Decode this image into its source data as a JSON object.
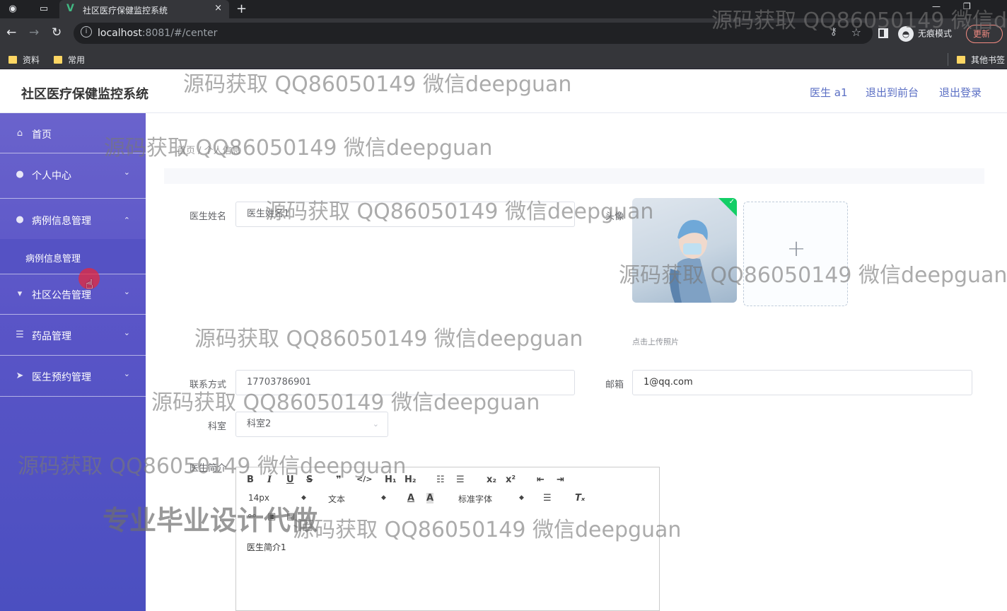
{
  "browser": {
    "tab_title": "社区医疗保健监控系统",
    "tab_close": "×",
    "new_tab": "+",
    "url_host": "localhost",
    "url_rest": ":8081/#/center",
    "incognito_label": "无痕模式",
    "update_label": "更新",
    "bookmarks": [
      "资料",
      "常用"
    ],
    "other_bookmarks": "其他书签"
  },
  "header": {
    "title": "社区医疗保健监控系统",
    "links": [
      "医生 a1",
      "退出到前台",
      "退出登录"
    ]
  },
  "sidebar": {
    "items": [
      {
        "label": "首页",
        "icon": "home-icon",
        "arrow": ""
      },
      {
        "label": "个人中心",
        "icon": "user-icon",
        "arrow": "⌄"
      },
      {
        "label": "病例信息管理",
        "icon": "user-icon",
        "arrow": "⌃"
      },
      {
        "label": "社区公告管理",
        "icon": "notice-icon",
        "arrow": "⌄"
      },
      {
        "label": "药品管理",
        "icon": "list-icon",
        "arrow": "⌄"
      },
      {
        "label": "医生预约管理",
        "icon": "send-icon",
        "arrow": "⌄"
      }
    ],
    "submenu_label": "病例信息管理"
  },
  "breadcrumb": "首页 / 个人信息",
  "form": {
    "name_label": "医生姓名",
    "name_value": "医生姓名1",
    "avatar_label": "头像",
    "upload_tip": "点击上传照片",
    "phone_label": "联系方式",
    "phone_value": "17703786901",
    "email_label": "邮箱",
    "email_value": "1@qq.com",
    "dept_label": "科室",
    "dept_value": "科室2",
    "intro_label": "医生简介",
    "intro_value": "医生简介1"
  },
  "editor_toolbar": {
    "font_size": "14px",
    "text_style": "文本",
    "font_family": "标准字体"
  },
  "watermark": {
    "text": "源码获取 QQ86050149 微信deepguan",
    "top_right": "源码获取 QQ86050149 微信de",
    "big": "专业毕业设计代做"
  },
  "colors": {
    "sidebar_top": "#6a63cc",
    "sidebar_bottom": "#4b4fc0",
    "link": "#5b6fc4"
  }
}
